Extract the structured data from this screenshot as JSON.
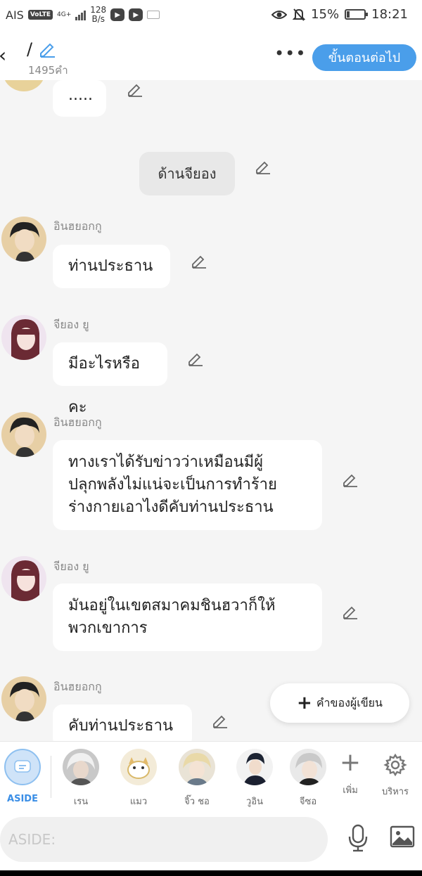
{
  "status_bar": {
    "carrier": "AIS",
    "volte": "VoLTE",
    "network": "4G+",
    "speed_value": "128",
    "speed_unit": "B/s",
    "battery_percent": "15%",
    "battery_level": 0.15,
    "time": "18:21"
  },
  "header": {
    "title": "/",
    "word_count": "1495คำ",
    "next_button": "ขั้นตอนต่อไป",
    "accent_color": "#4a9eea"
  },
  "chat": {
    "partial_bubble": ".....",
    "narration": "ด้านจียอง",
    "messages": [
      {
        "speaker": "อินฮยอกกู",
        "text": "ท่านประธาน"
      },
      {
        "speaker": "จียอง ยู",
        "text": "มีอะไรหรือคะ"
      },
      {
        "speaker": "อินฮยอกกู",
        "lines": [
          "ทางเราได้รับข่าวว่าเหมือนมีผู้",
          "ปลุกพลังไม่แน่จะเป็นการทำร้าย",
          "ร่างกายเอาไงดีคับท่านประธาน"
        ]
      },
      {
        "speaker": "จียอง ยู",
        "lines": [
          "มันอยู่ในเขตสมาคมชินฮวาก็ให้",
          "พวกเขาการ"
        ]
      },
      {
        "speaker": "อินฮยอกกู",
        "text": "คับท่านประธาน"
      }
    ]
  },
  "fab": {
    "label": "คำของผู้เขียน"
  },
  "characters": {
    "aside": "ASIDE",
    "items": [
      {
        "name": "เรน"
      },
      {
        "name": "แมว"
      },
      {
        "name": "จิ๊ว ชอ"
      },
      {
        "name": "วูอิน"
      },
      {
        "name": "จีซอ"
      }
    ],
    "add_label": "เพิ่ม",
    "manage_label": "บริหาร"
  },
  "input": {
    "placeholder": "ASIDE:"
  }
}
